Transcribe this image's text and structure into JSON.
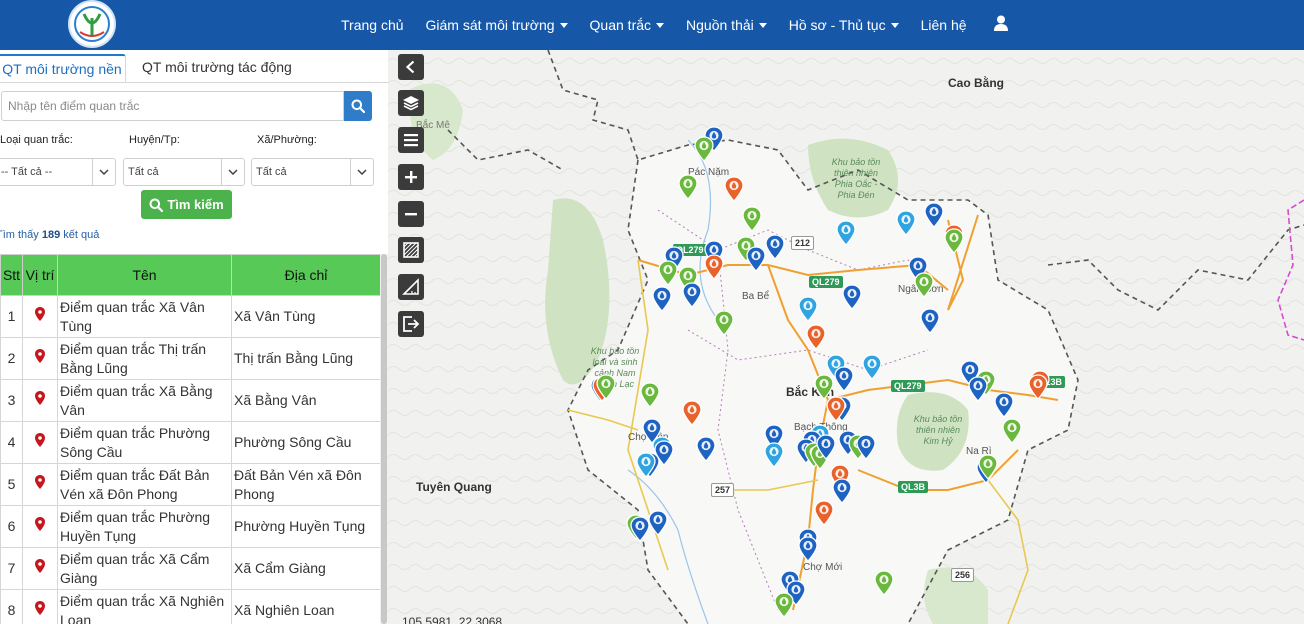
{
  "nav": {
    "items": [
      {
        "label": "Trang chủ",
        "dropdown": false
      },
      {
        "label": "Giám sát môi trường",
        "dropdown": true
      },
      {
        "label": "Quan trắc",
        "dropdown": true
      },
      {
        "label": "Nguồn thải",
        "dropdown": true
      },
      {
        "label": "Hồ sơ - Thủ tục",
        "dropdown": true
      },
      {
        "label": "Liên hệ",
        "dropdown": false
      }
    ],
    "user_icon": "user-icon"
  },
  "tabs": {
    "active": "QT môi trường nền",
    "other": "QT môi trường tác động"
  },
  "search": {
    "placeholder": "Nhập tên điểm quan trắc",
    "value": ""
  },
  "filters": {
    "type_label": "Loại quan trắc:",
    "type_value": "-- Tất cả --",
    "district_label": "Huyện/Tp:",
    "district_value": "Tất cả",
    "commune_label": "Xã/Phường:",
    "commune_value": "Tất cả"
  },
  "find_button": "Tìm kiếm",
  "results": {
    "prefix": "Tìm thấy ",
    "count": "189",
    "suffix": " kết quả"
  },
  "table": {
    "headers": {
      "stt": "Stt",
      "pos": "Vị trí",
      "name": "Tên",
      "address": "Địa chỉ"
    },
    "rows": [
      {
        "stt": "1",
        "name": "Điểm quan trắc Xã Vân Tùng",
        "address": "Xã Vân Tùng"
      },
      {
        "stt": "2",
        "name": "Điểm quan trắc Thị trấn Bằng Lũng",
        "address": "Thị trấn Bằng Lũng"
      },
      {
        "stt": "3",
        "name": "Điểm quan trắc Xã Bằng Vân",
        "address": "Xã Bằng Vân"
      },
      {
        "stt": "4",
        "name": "Điểm quan trắc Phường Sông Cầu",
        "address": "Phường Sông Cầu"
      },
      {
        "stt": "5",
        "name": "Điểm quan trắc Đất Bản Vén xã Đôn Phong",
        "address": "Đất Bản Vén xã Đôn Phong"
      },
      {
        "stt": "6",
        "name": "Điểm quan trắc Phường Huyền Tụng",
        "address": "Phường Huyền Tụng"
      },
      {
        "stt": "7",
        "name": "Điểm quan trắc Xã Cẩm Giàng",
        "address": "Xã Cẩm Giàng"
      },
      {
        "stt": "8",
        "name": "Điểm quan trắc Xã Nghiên Loan",
        "address": "Xã Nghiên Loan"
      }
    ]
  },
  "map": {
    "places": {
      "cao_bang": "Cao Bằng",
      "tuyen_quang": "Tuyên Quang",
      "bac_kan": "Bắc Kạn",
      "ba_be": "Ba Bể",
      "ngan_son": "Ngân Sơn",
      "na_ri": "Na Rì",
      "pac_nam": "Pác Nặm",
      "cho_don": "Chợ Đồn",
      "bach_thong": "Bạch Thông",
      "cho_moi": "Chợ Mới",
      "bac_me": "Bắc Mê"
    },
    "parks": {
      "phia_oac": "Khu bảo tồn\nthiên nhiên\nPhia Oắc -\nPhia Đén",
      "nam_xuan_lac": "Khu bảo tồn\nloài và sinh\ncảnh Nam\nXuân Lạc",
      "kim_hy": "Khu bảo tồn\nthiên nhiên\nKim Hỷ"
    },
    "roads": [
      "QL279",
      "QL279",
      "QL279",
      "QL3B",
      "QL3B",
      "212",
      "257",
      "256"
    ],
    "coords": "105.5981, 22.3068",
    "tools": [
      "back-icon",
      "layers-icon",
      "menu-icon",
      "zoom-in-icon",
      "zoom-out-icon",
      "select-area-icon",
      "measure-icon",
      "export-icon"
    ],
    "colors": {
      "blue": "#1f63c2",
      "green": "#6ab83e",
      "orange": "#e8622c",
      "light_blue": "#2fa4e0",
      "nav": "#1657a8",
      "table_header": "#57c957"
    }
  }
}
